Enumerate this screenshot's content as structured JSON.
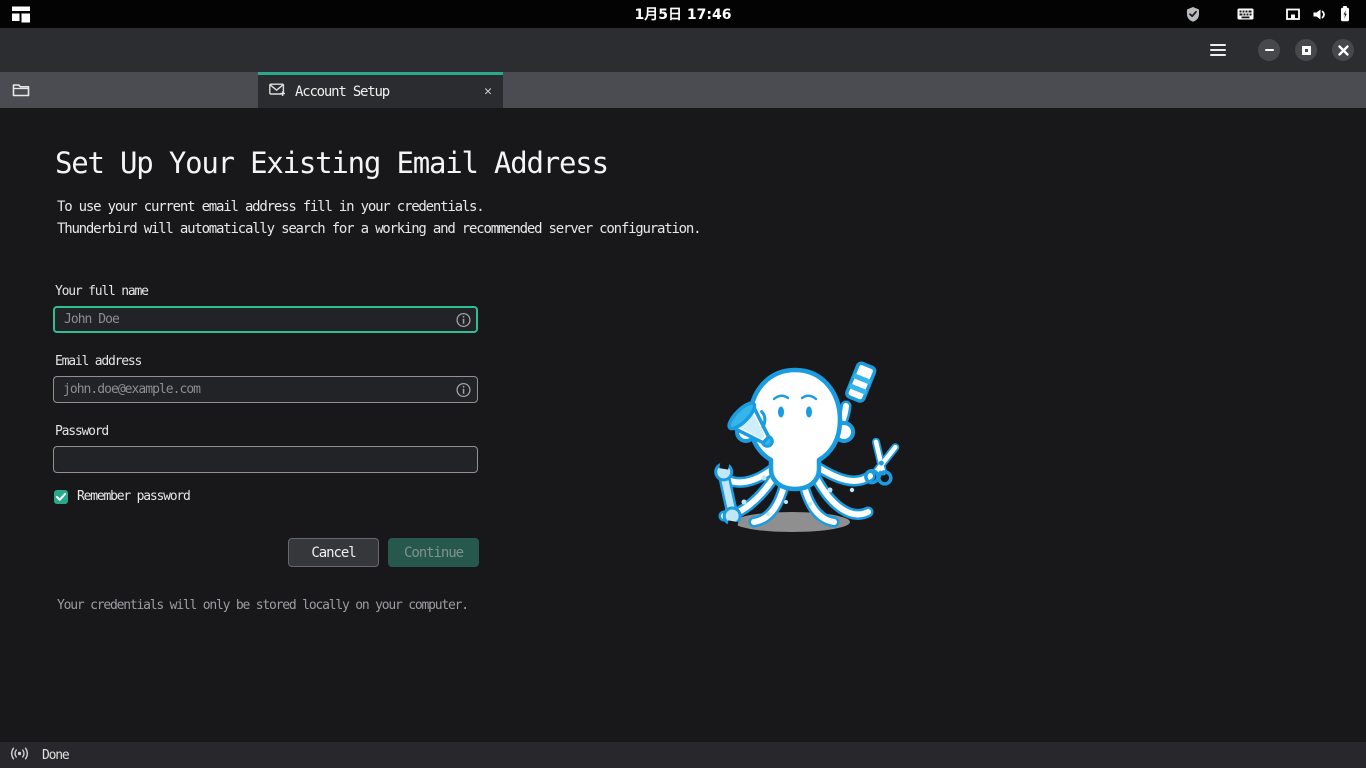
{
  "topbar": {
    "datetime": "1月5日 17:46"
  },
  "window": {
    "tab_label": "Account Setup",
    "tab_close_glyph": "✕"
  },
  "setup": {
    "heading": "Set Up Your Existing Email Address",
    "subtitle_line1": "To use your current email address fill in your credentials.",
    "subtitle_line2": "Thunderbird will automatically search for a working and recommended server configuration.",
    "fields": {
      "full_name": {
        "label": "Your full name",
        "placeholder": "John Doe",
        "value": ""
      },
      "email": {
        "label": "Email address",
        "placeholder": "john.doe@example.com",
        "value": ""
      },
      "password": {
        "label": "Password",
        "placeholder": "",
        "value": ""
      }
    },
    "remember_password": {
      "label": "Remember password",
      "checked": true
    },
    "buttons": {
      "cancel": "Cancel",
      "continue": "Continue"
    },
    "footer_note": "Your credentials will only be stored locally on your computer."
  },
  "statusbar": {
    "status": "Done"
  },
  "colors": {
    "accent": "#2aa98a",
    "focus_border": "#2fbf8e",
    "continue_bg": "#27584e",
    "mascot_blue": "#1b9ce0"
  }
}
